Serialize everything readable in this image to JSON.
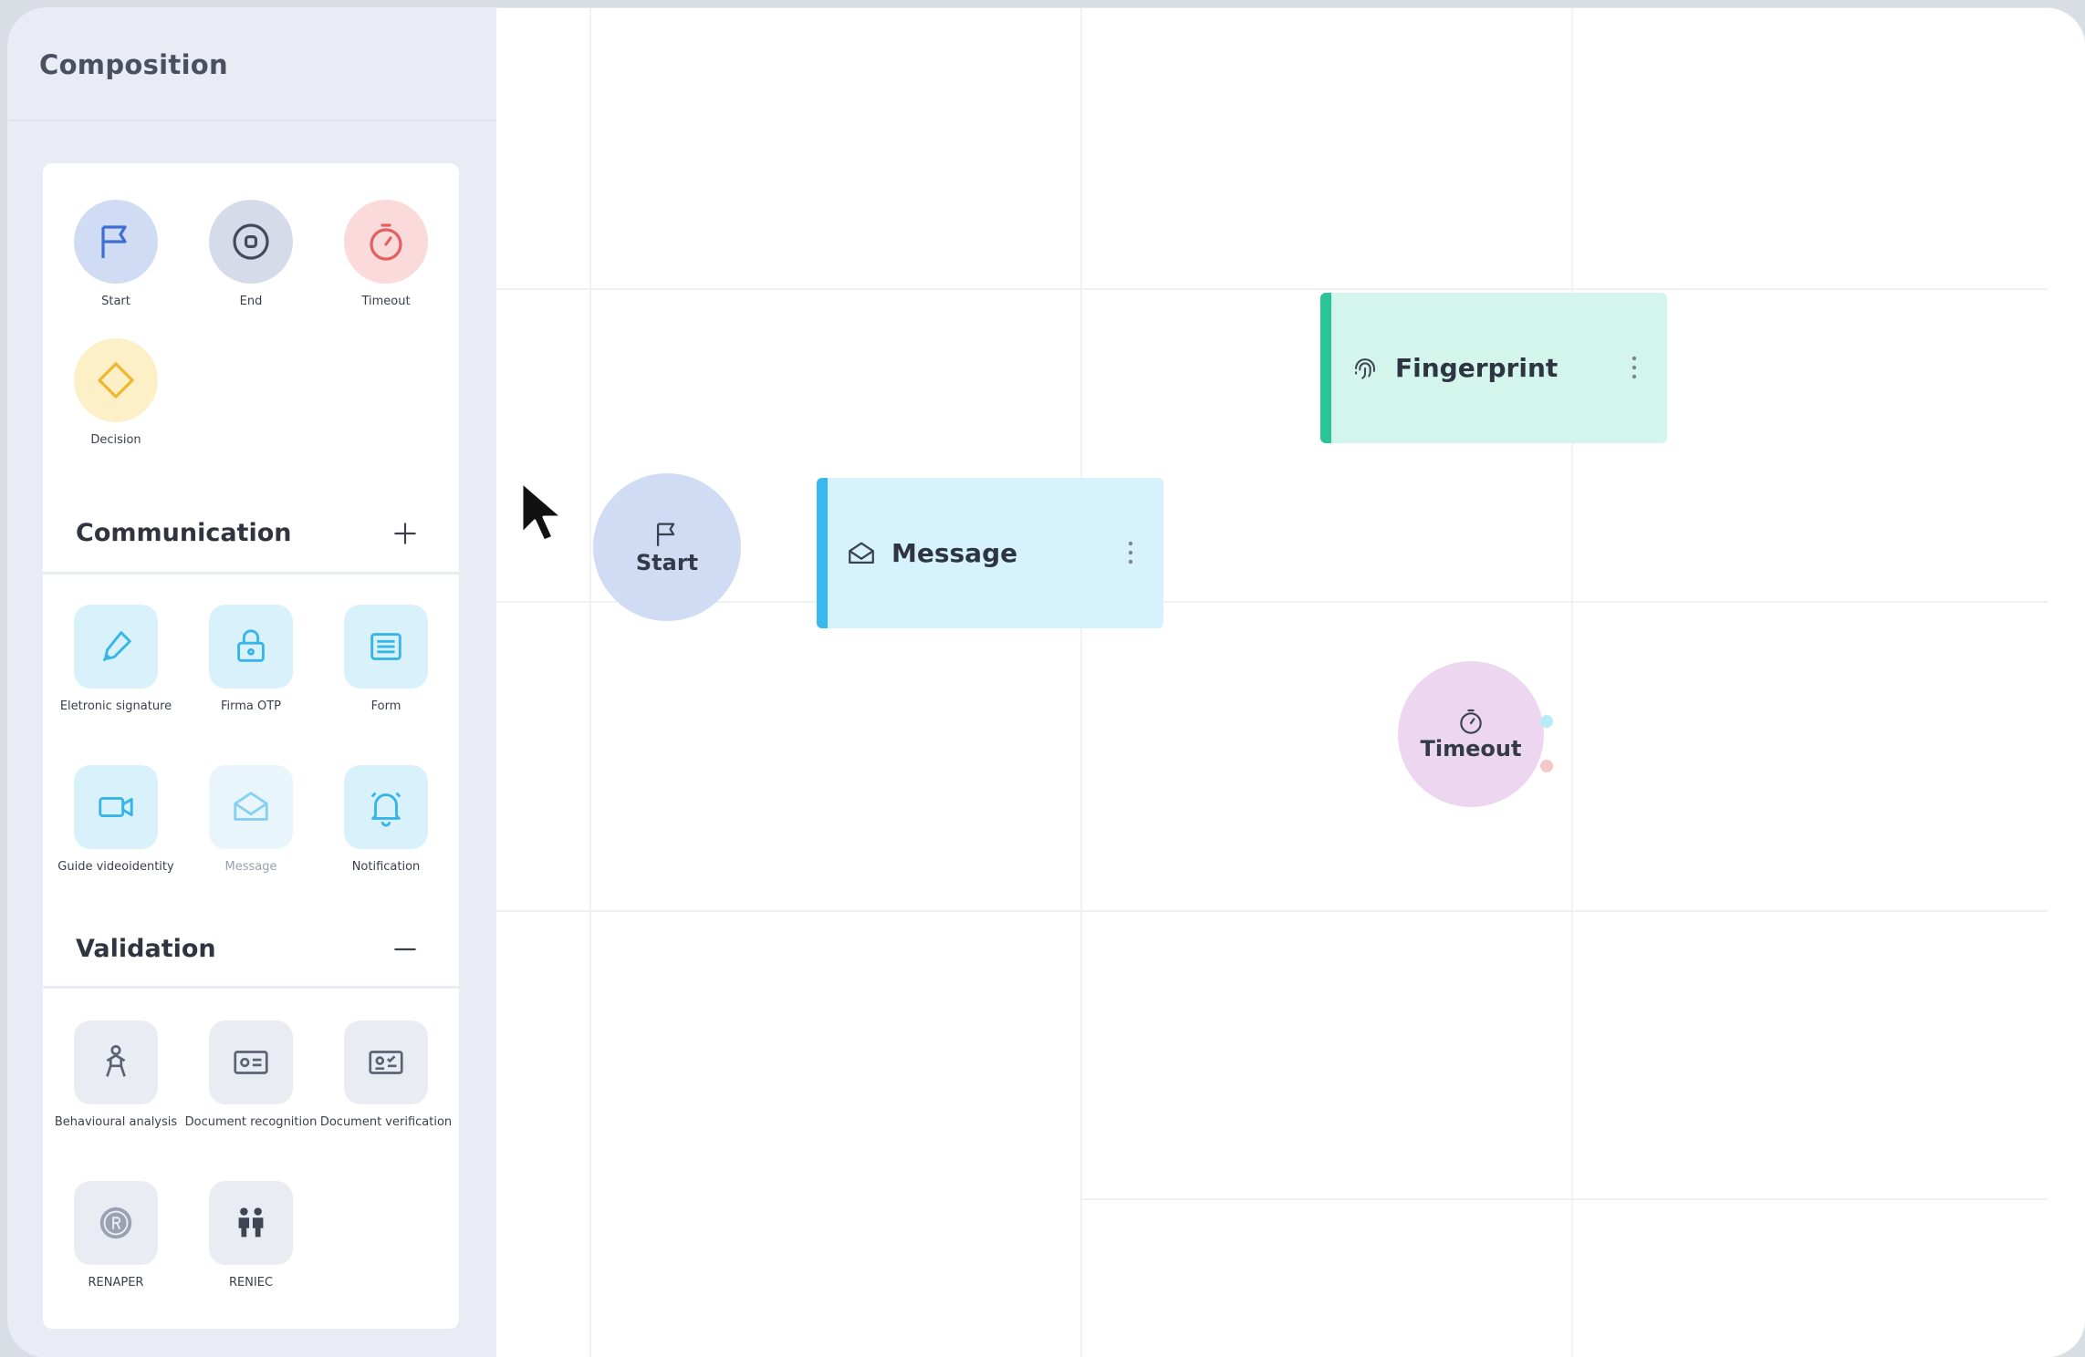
{
  "sidebar": {
    "title": "Composition",
    "basic": [
      {
        "label": "Start",
        "icon": "flag-icon"
      },
      {
        "label": "End",
        "icon": "stop-circle-icon"
      },
      {
        "label": "Timeout",
        "icon": "stopwatch-icon"
      },
      {
        "label": "Decision",
        "icon": "diamond-icon"
      }
    ],
    "communication": {
      "title": "Communication",
      "toggle": "+",
      "items": [
        {
          "label": "Eletronic signature",
          "icon": "pen-icon"
        },
        {
          "label": "Firma OTP",
          "icon": "lock-icon"
        },
        {
          "label": "Form",
          "icon": "form-icon"
        },
        {
          "label": "Guide videoidentity",
          "icon": "video-camera-icon"
        },
        {
          "label": "Message",
          "icon": "envelope-icon"
        },
        {
          "label": "Notification",
          "icon": "bell-icon"
        }
      ]
    },
    "validation": {
      "title": "Validation",
      "toggle": "—",
      "items": [
        {
          "label": "Behavioural analysis",
          "icon": "person-icon"
        },
        {
          "label": "Document recognition",
          "icon": "id-card-icon"
        },
        {
          "label": "Document verification",
          "icon": "id-card-check-icon"
        },
        {
          "label": "RENAPER",
          "icon": "renaper-seal-icon"
        },
        {
          "label": "RENIEC",
          "icon": "reniec-people-icon"
        }
      ]
    }
  },
  "canvas": {
    "nodes": {
      "start": {
        "label": "Start",
        "icon": "flag-icon"
      },
      "message": {
        "label": "Message",
        "icon": "envelope-open-icon",
        "menu": "⋮"
      },
      "fingerprint": {
        "label": "Fingerprint",
        "icon": "fingerprint-icon",
        "menu": "⋮"
      },
      "timeout": {
        "label": "Timeout",
        "icon": "stopwatch-icon"
      }
    }
  },
  "colors": {
    "start": "#cfdcf3",
    "end": "#d6dbea",
    "timeout_basic": "#fadadb",
    "decision": "#fdf0c6",
    "comm_tile": "#d9f1fb",
    "validation_tile": "#e9ecf3",
    "message_card": "#d6f2fc",
    "message_bar": "#38b8ef",
    "fingerprint_card": "#d4f5ec",
    "fingerprint_bar": "#29c497",
    "timeout_node": "#ecd6f0"
  }
}
